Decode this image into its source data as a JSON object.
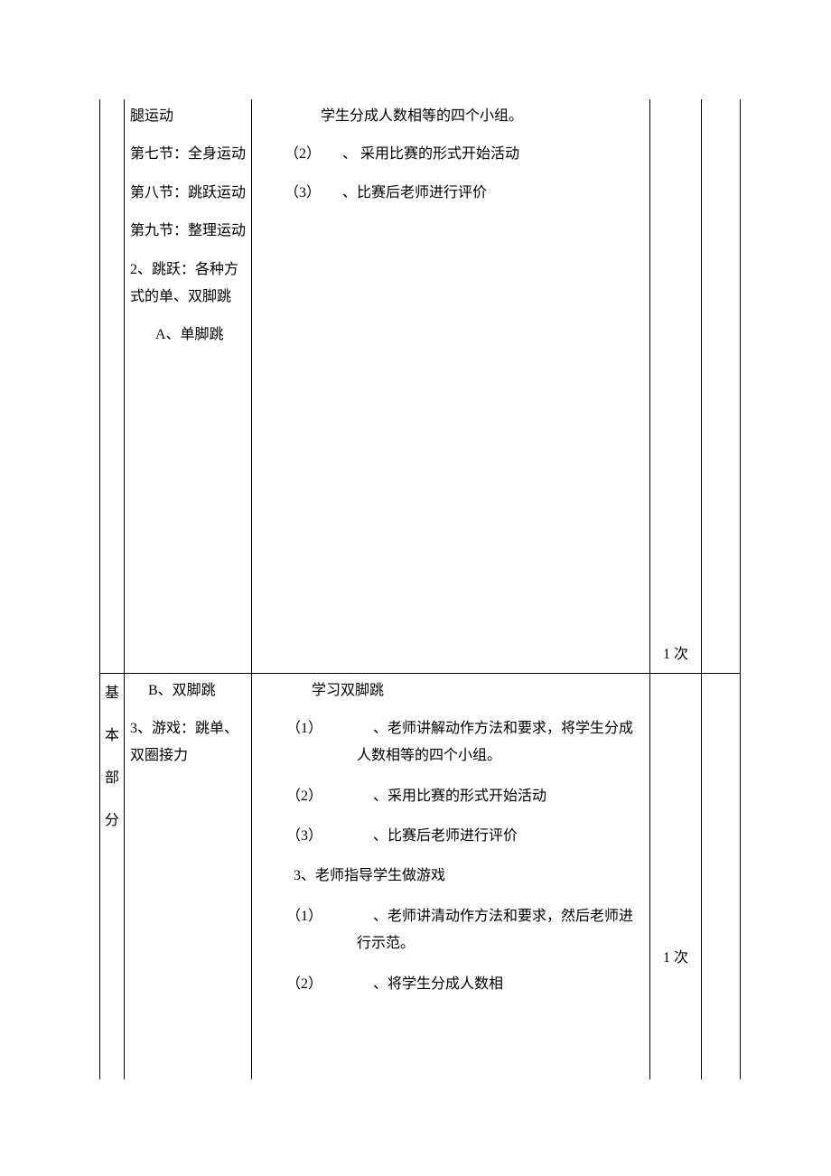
{
  "row1": {
    "col2": {
      "l1": "腿运动",
      "l2": "第七节：全身运动",
      "l3": "第八节：跳跃运动",
      "l4": "第九节：整理运动",
      "l5": "2、跳跃：各种方式的单、双脚跳",
      "l6": "A、单脚跳"
    },
    "col3": {
      "l1": "学生分成人数相等的四个小组。",
      "l2": "（2）　　、 采用比赛的形式开始活动",
      "l3": "（3）　　、比赛后老师进行评价"
    },
    "count": "1 次"
  },
  "row2": {
    "label": {
      "c1": "基",
      "c2": "本",
      "c3": "部",
      "c4": "分"
    },
    "col2": {
      "l1": "B、双脚跳",
      "l2": "3、游戏：跳单、双圈接力"
    },
    "col3": {
      "l1": "学习双脚跳",
      "l2": "（1）　　　　、老师讲解动作方法和要求，将学生分成人数相等的四个小组。",
      "l3": "（2）　　　　、采用比赛的形式开始活动",
      "l4": "（3）　　　　、比赛后老师进行评价",
      "l5": "3、老师指导学生做游戏",
      "l6": "（1）　　　　、老师讲清动作方法和要求，然后老师进行示范。",
      "l7": "（2）　　　　、将学生分成人数相"
    },
    "count": "1 次"
  }
}
